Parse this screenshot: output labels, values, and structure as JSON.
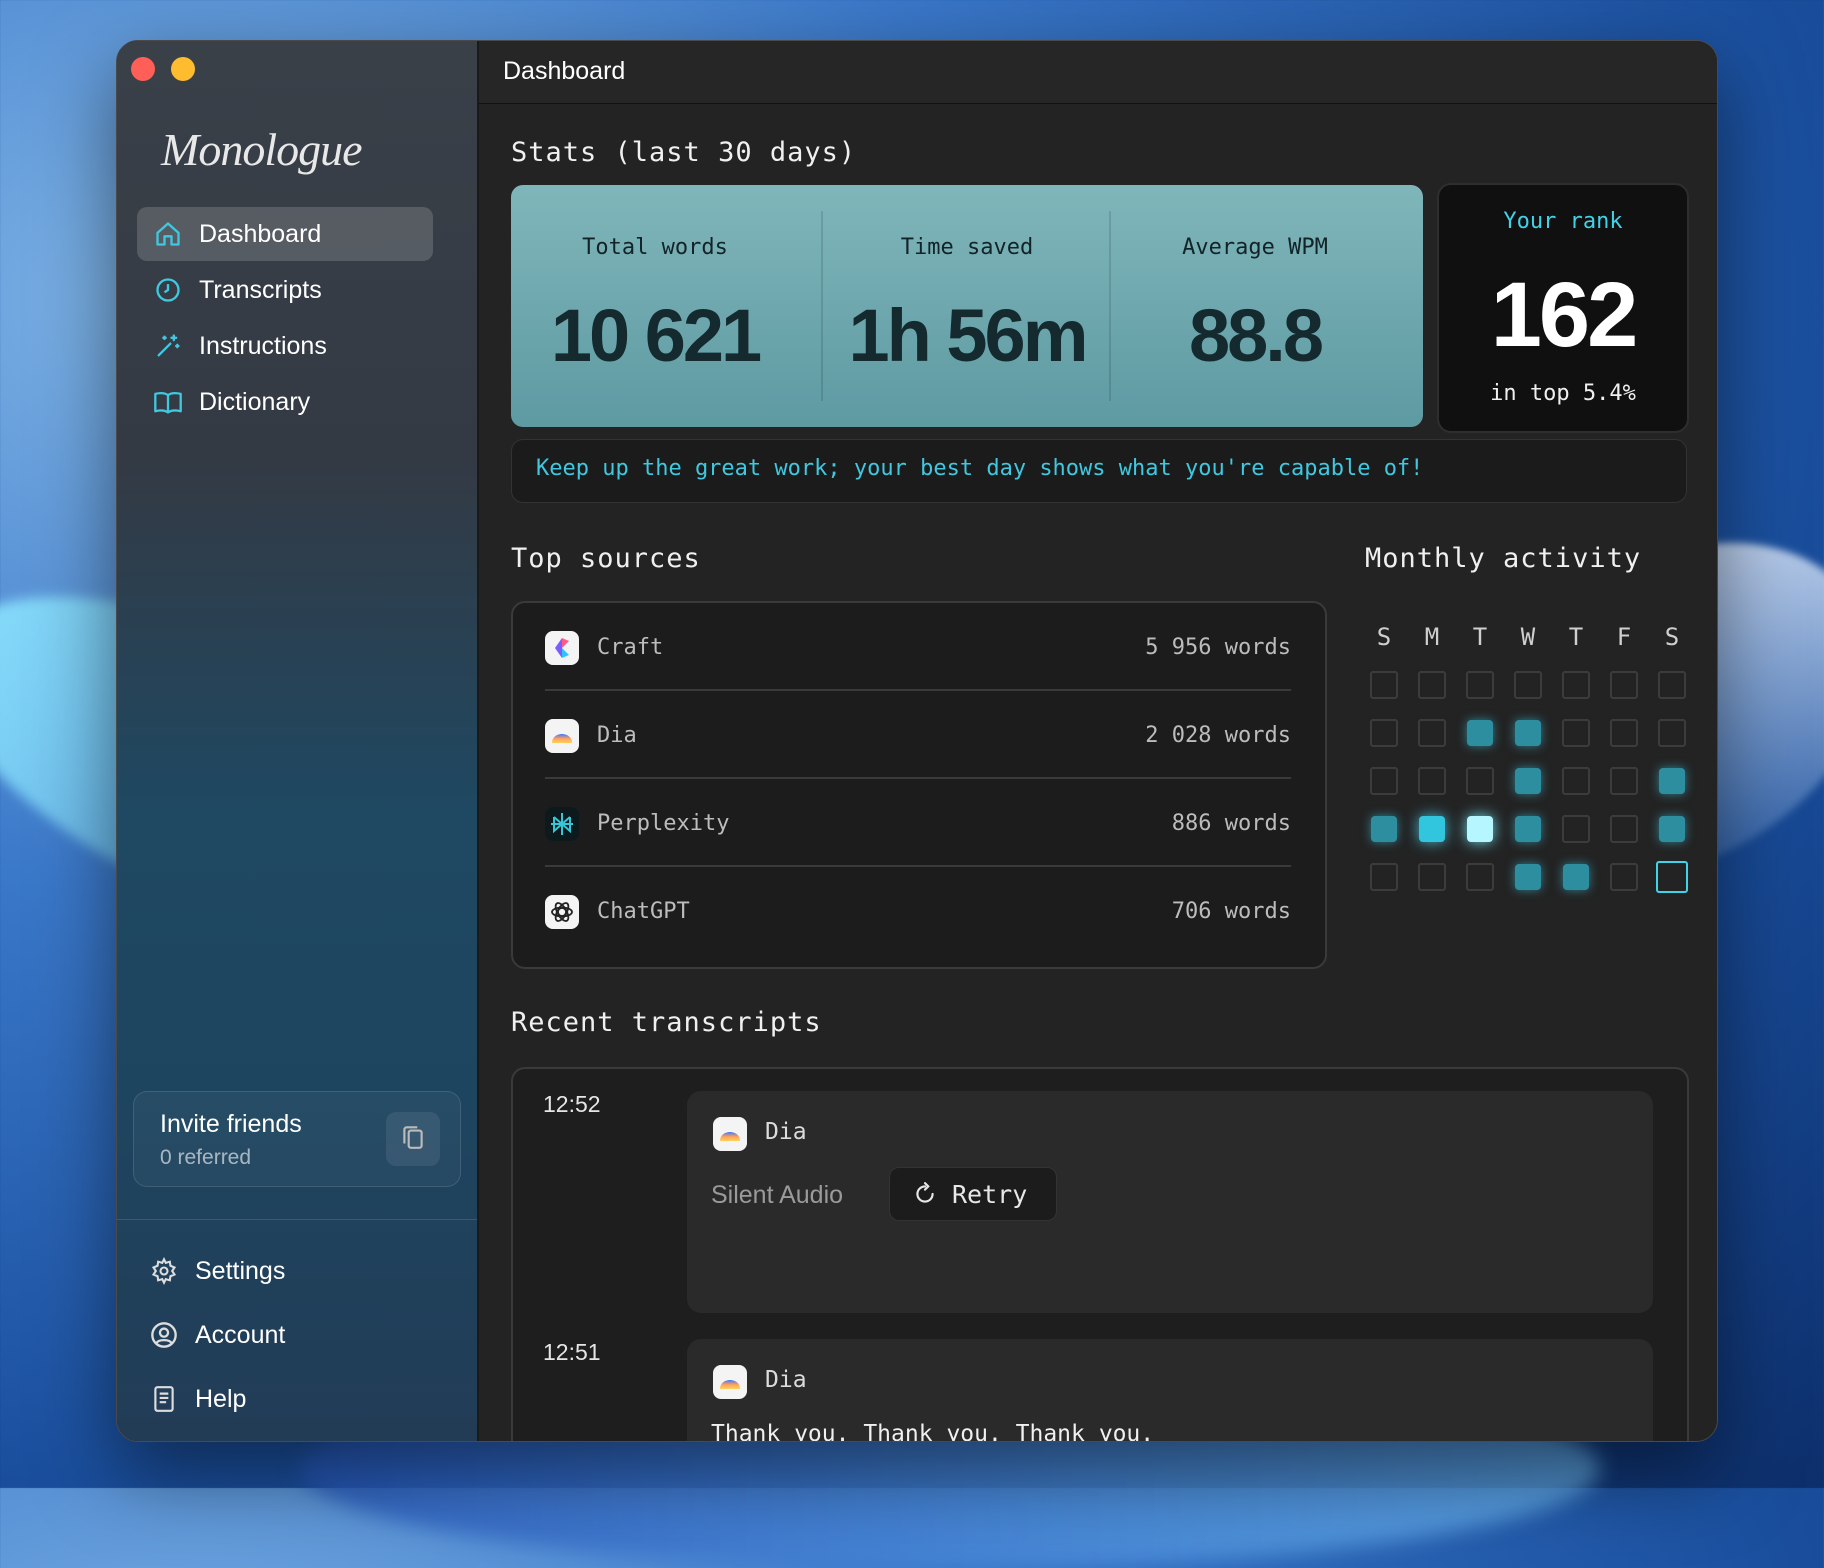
{
  "app": {
    "name": "Monologue",
    "title": "Dashboard"
  },
  "sidebar": {
    "items": [
      {
        "label": "Dashboard",
        "icon": "home-icon"
      },
      {
        "label": "Transcripts",
        "icon": "clock-icon"
      },
      {
        "label": "Instructions",
        "icon": "sparkle-wand-icon"
      },
      {
        "label": "Dictionary",
        "icon": "book-icon"
      }
    ],
    "invite": {
      "title": "Invite friends",
      "subtitle": "0 referred"
    },
    "bottom": [
      {
        "label": "Settings",
        "icon": "gear-icon"
      },
      {
        "label": "Account",
        "icon": "user-circle-icon"
      },
      {
        "label": "Help",
        "icon": "document-icon"
      }
    ]
  },
  "stats": {
    "title": "Stats (last 30 days)",
    "total_words_label": "Total words",
    "total_words": "10 621",
    "time_saved_label": "Time saved",
    "time_saved": "1h 56m",
    "avg_wpm_label": "Average WPM",
    "avg_wpm": "88.8",
    "rank_label": "Your rank",
    "rank": "162",
    "rank_sub": "in top 5.4%",
    "motivation": "Keep up the great work; your best day shows what you're capable of!"
  },
  "sources": {
    "title": "Top sources",
    "items": [
      {
        "name": "Craft",
        "count": "5 956 words",
        "icon": "craft-icon"
      },
      {
        "name": "Dia",
        "count": "2 028 words",
        "icon": "dia-icon"
      },
      {
        "name": "Perplexity",
        "count": "886 words",
        "icon": "perplexity-icon"
      },
      {
        "name": "ChatGPT",
        "count": "706 words",
        "icon": "chatgpt-icon"
      }
    ]
  },
  "activity": {
    "title": "Monthly activity",
    "days": [
      "S",
      "M",
      "T",
      "W",
      "T",
      "F",
      "S"
    ],
    "levels": [
      [
        0,
        0,
        0,
        0,
        0,
        0,
        0
      ],
      [
        0,
        0,
        1,
        1,
        0,
        0,
        0
      ],
      [
        0,
        0,
        0,
        1,
        0,
        0,
        1
      ],
      [
        1,
        2,
        3,
        1,
        0,
        0,
        1
      ],
      [
        0,
        0,
        0,
        1,
        1,
        0,
        "today"
      ]
    ],
    "accent": "#3fd3e8"
  },
  "recent": {
    "title": "Recent transcripts",
    "items": [
      {
        "time": "12:52",
        "app": "Dia",
        "status": "Silent Audio",
        "action": "Retry"
      },
      {
        "time": "12:51",
        "app": "Dia",
        "text": "Thank you. Thank you. Thank you."
      }
    ]
  }
}
